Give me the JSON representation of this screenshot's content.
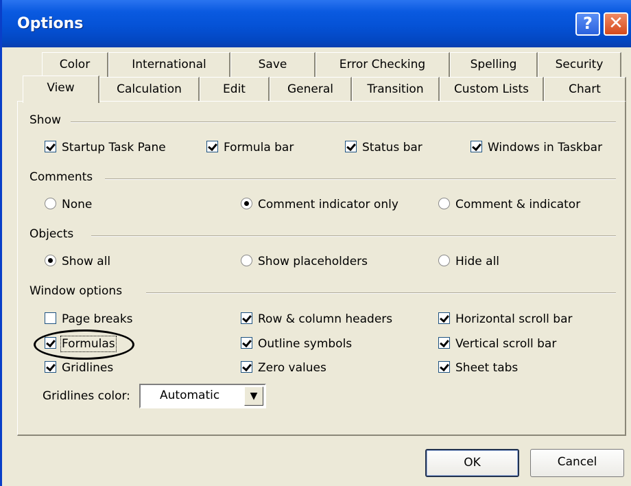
{
  "window": {
    "title": "Options",
    "help_glyph": "?",
    "close_glyph": "✕"
  },
  "tabs_row1": [
    "Color",
    "International",
    "Save",
    "Error Checking",
    "Spelling",
    "Security"
  ],
  "tabs_row2": [
    "View",
    "Calculation",
    "Edit",
    "General",
    "Transition",
    "Custom Lists",
    "Chart"
  ],
  "selected_tab": "View",
  "show": {
    "label": "Show",
    "items": [
      {
        "label": "Startup Task Pane",
        "checked": true
      },
      {
        "label": "Formula bar",
        "checked": true
      },
      {
        "label": "Status bar",
        "checked": true
      },
      {
        "label": "Windows in Taskbar",
        "checked": true
      }
    ]
  },
  "comments": {
    "label": "Comments",
    "items": [
      {
        "label": "None",
        "selected": false
      },
      {
        "label": "Comment indicator only",
        "selected": true
      },
      {
        "label": "Comment & indicator",
        "selected": false
      }
    ]
  },
  "objects": {
    "label": "Objects",
    "items": [
      {
        "label": "Show all",
        "selected": true
      },
      {
        "label": "Show placeholders",
        "selected": false
      },
      {
        "label": "Hide all",
        "selected": false
      }
    ]
  },
  "window_options": {
    "label": "Window options",
    "items": [
      {
        "label": "Page breaks",
        "checked": false
      },
      {
        "label": "Row & column headers",
        "checked": true
      },
      {
        "label": "Horizontal scroll bar",
        "checked": true
      },
      {
        "label": "Formulas",
        "checked": true
      },
      {
        "label": "Outline symbols",
        "checked": true
      },
      {
        "label": "Vertical scroll bar",
        "checked": true
      },
      {
        "label": "Gridlines",
        "checked": true
      },
      {
        "label": "Zero values",
        "checked": true
      },
      {
        "label": "Sheet tabs",
        "checked": true
      }
    ],
    "gridlines_color_label": "Gridlines color:",
    "gridlines_color_value": "Automatic"
  },
  "buttons": {
    "ok": "OK",
    "cancel": "Cancel"
  }
}
